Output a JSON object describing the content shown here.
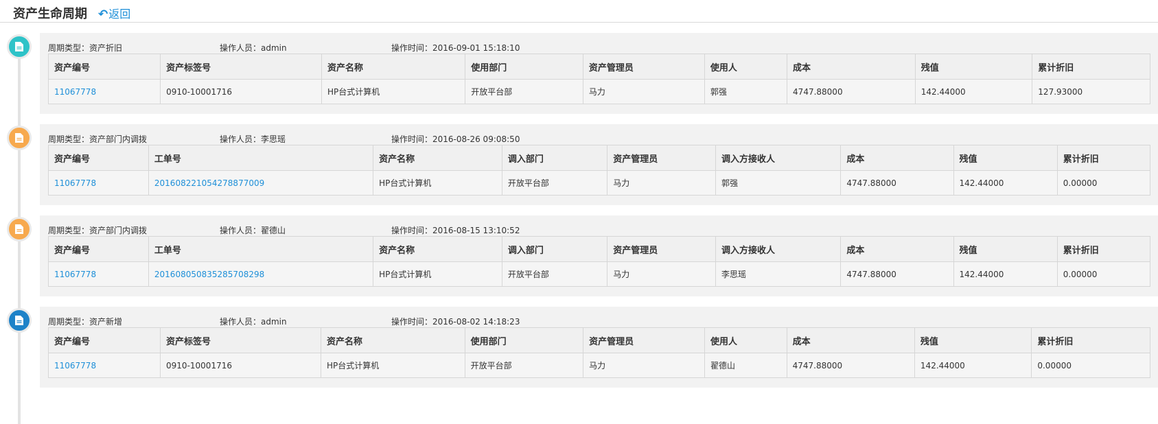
{
  "header": {
    "title": "资产生命周期",
    "back_label": "返回"
  },
  "colors": {
    "teal": "#2ec3c8",
    "orange": "#f7a94e",
    "blue": "#1e82c8",
    "link": "#1e8fd8"
  },
  "entries": [
    {
      "icon": "document-icon",
      "color": "teal",
      "meta": {
        "type": "周期类型：资产折旧",
        "operator": "操作人员：admin",
        "time": "操作时间：2016-09-01 15:18:10"
      },
      "columns": [
        "资产编号",
        "资产标签号",
        "资产名称",
        "使用部门",
        "资产管理员",
        "使用人",
        "成本",
        "残值",
        "累计折旧"
      ],
      "row": [
        "11067778",
        "0910-10001716",
        "HP台式计算机",
        "开放平台部",
        "马力",
        "郭强",
        "4747.88000",
        "142.44000",
        "127.93000"
      ],
      "links": [
        0
      ]
    },
    {
      "icon": "document-icon",
      "color": "orange",
      "meta": {
        "type": "周期类型：资产部门内调拨",
        "operator": "操作人员：李思瑶",
        "time": "操作时间：2016-08-26 09:08:50"
      },
      "columns": [
        "资产编号",
        "工单号",
        "资产名称",
        "调入部门",
        "资产管理员",
        "调入方接收人",
        "成本",
        "残值",
        "累计折旧"
      ],
      "row": [
        "11067778",
        "201608221054278877009",
        "HP台式计算机",
        "开放平台部",
        "马力",
        "郭强",
        "4747.88000",
        "142.44000",
        "0.00000"
      ],
      "links": [
        0,
        1
      ]
    },
    {
      "icon": "document-icon",
      "color": "orange",
      "meta": {
        "type": "周期类型：资产部门内调拨",
        "operator": "操作人员：翟德山",
        "time": "操作时间：2016-08-15 13:10:52"
      },
      "columns": [
        "资产编号",
        "工单号",
        "资产名称",
        "调入部门",
        "资产管理员",
        "调入方接收人",
        "成本",
        "残值",
        "累计折旧"
      ],
      "row": [
        "11067778",
        "201608050835285708298",
        "HP台式计算机",
        "开放平台部",
        "马力",
        "李思瑶",
        "4747.88000",
        "142.44000",
        "0.00000"
      ],
      "links": [
        0,
        1
      ]
    },
    {
      "icon": "document-icon",
      "color": "blue",
      "meta": {
        "type": "周期类型：资产新增",
        "operator": "操作人员：admin",
        "time": "操作时间：2016-08-02 14:18:23"
      },
      "columns": [
        "资产编号",
        "资产标签号",
        "资产名称",
        "使用部门",
        "资产管理员",
        "使用人",
        "成本",
        "残值",
        "累计折旧"
      ],
      "row": [
        "11067778",
        "0910-10001716",
        "HP台式计算机",
        "开放平台部",
        "马力",
        "翟德山",
        "4747.88000",
        "142.44000",
        "0.00000"
      ],
      "links": [
        0
      ]
    }
  ]
}
